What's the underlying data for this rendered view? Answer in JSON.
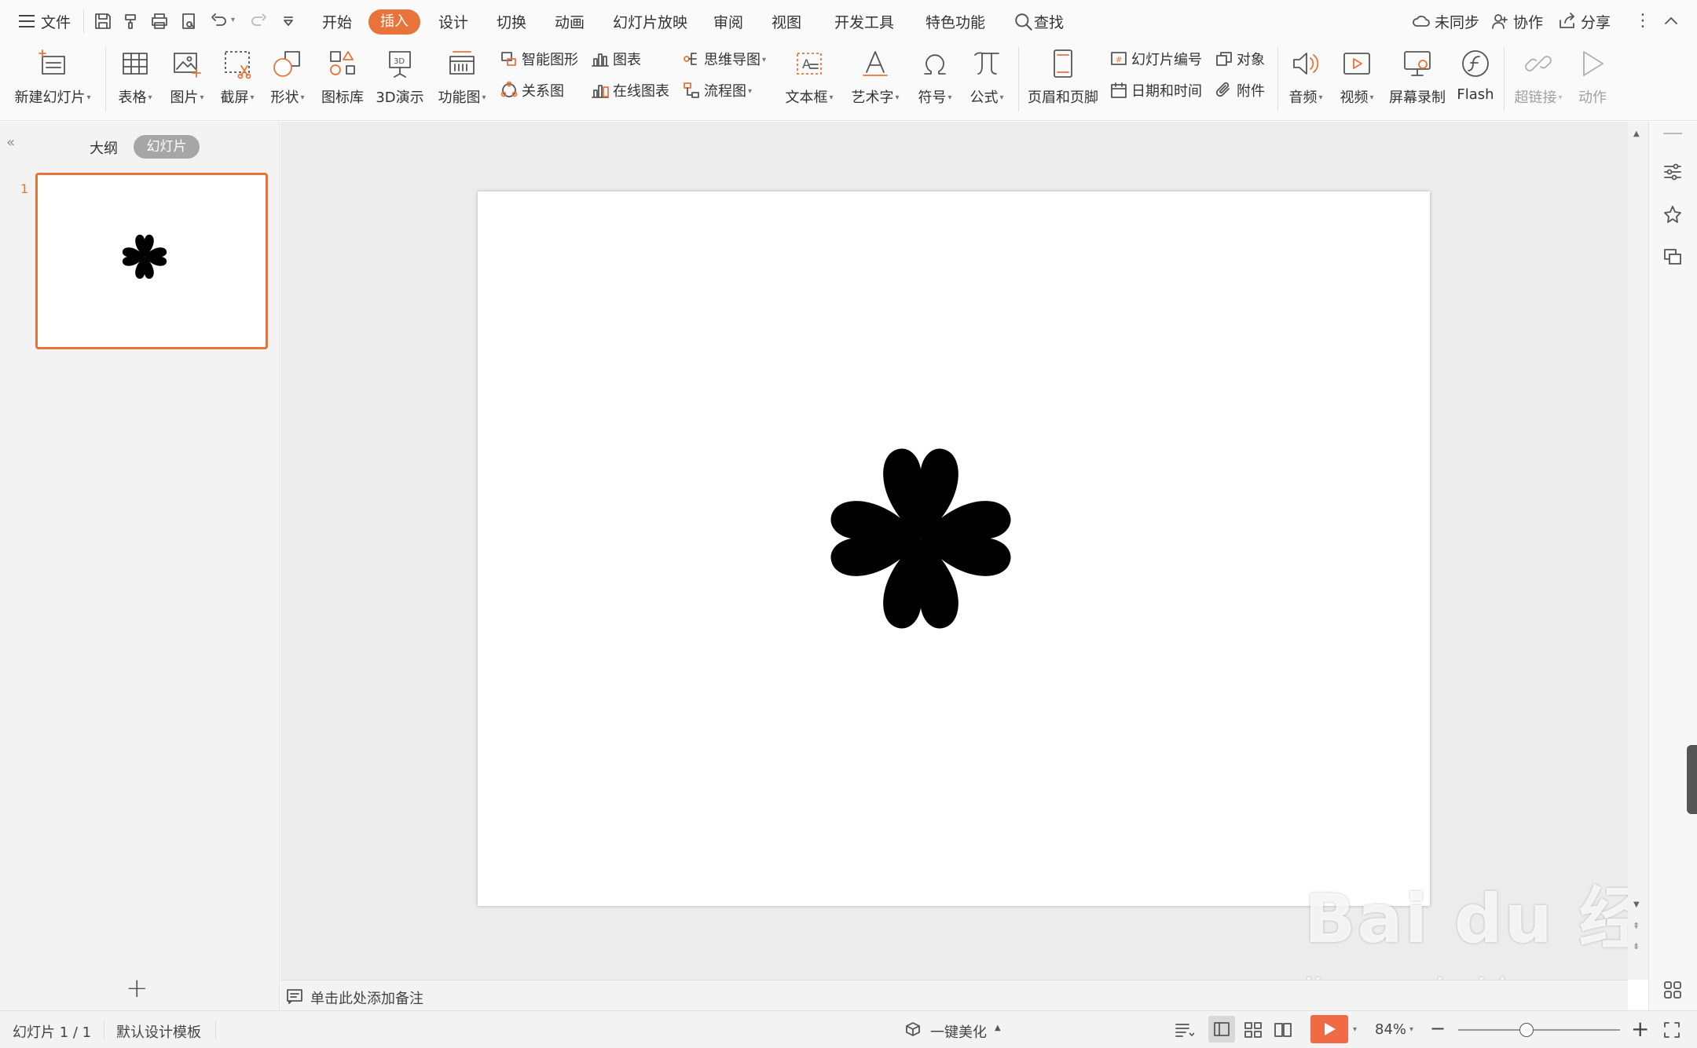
{
  "menubar": {
    "file": "文件",
    "tabs": [
      "开始",
      "插入",
      "设计",
      "切换",
      "动画",
      "幻灯片放映",
      "审阅",
      "视图",
      "开发工具",
      "特色功能"
    ],
    "search": "查找",
    "sync": "未同步",
    "collab": "协作",
    "share": "分享"
  },
  "ribbon": {
    "new_slide": "新建幻灯片",
    "table": "表格",
    "picture": "图片",
    "screenshot": "截屏",
    "shape": "形状",
    "icon_lib": "图标库",
    "demo3d": "3D演示",
    "func_chart": "功能图",
    "smart_art": "智能图形",
    "chart": "图表",
    "mind_map": "思维导图",
    "relation": "关系图",
    "online_chart": "在线图表",
    "flowchart": "流程图",
    "textbox": "文本框",
    "word_art": "艺术字",
    "symbol": "符号",
    "formula": "公式",
    "header_footer": "页眉和页脚",
    "slide_number": "幻灯片编号",
    "object": "对象",
    "date_time": "日期和时间",
    "attachment": "附件",
    "audio": "音频",
    "video": "视频",
    "screen_record": "屏幕录制",
    "flash": "Flash",
    "hyperlink": "超链接",
    "action": "动作"
  },
  "leftpanel": {
    "tab_outline": "大纲",
    "tab_slides": "幻灯片",
    "slide_number": "1"
  },
  "notes": {
    "placeholder": "单击此处添加备注"
  },
  "watermark": {
    "brand": "Bai du 经验",
    "url": "jingyan.baidu.com"
  },
  "statusbar": {
    "slide_info": "幻灯片 1 / 1",
    "template": "默认设计模板",
    "beautify": "一键美化",
    "zoom": "84%",
    "zoom_level": 0.42
  },
  "colors": {
    "accent": "#e8743b",
    "clover_fill": "#92d050",
    "clover_stroke": "#8eaadb"
  }
}
